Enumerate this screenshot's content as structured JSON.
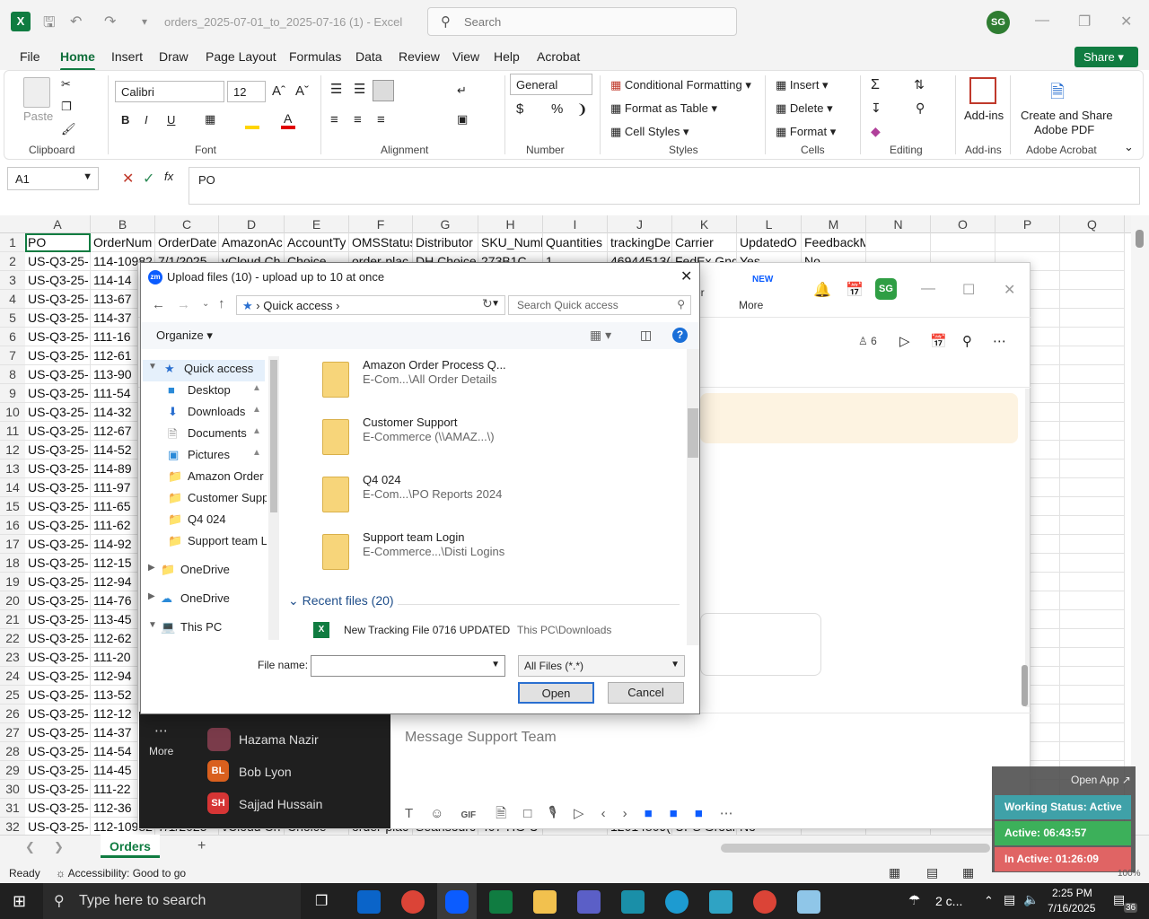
{
  "titlebar": {
    "doc_title": "orders_2025-07-01_to_2025-07-16 (1)  -  Excel",
    "search_placeholder": "Search",
    "user_initials": "SG"
  },
  "menu": {
    "items": [
      "File",
      "Home",
      "Insert",
      "Draw",
      "Page Layout",
      "Formulas",
      "Data",
      "Review",
      "View",
      "Help",
      "Acrobat"
    ],
    "share": "Share"
  },
  "ribbon": {
    "clipboard": {
      "paste": "Paste",
      "group": "Clipboard"
    },
    "font": {
      "name": "Calibri",
      "size": "12",
      "group": "Font",
      "bold": "B",
      "italic": "I",
      "underline": "U"
    },
    "alignment": {
      "group": "Alignment"
    },
    "number": {
      "format": "General",
      "group": "Number"
    },
    "styles": {
      "conditional": "Conditional Formatting",
      "format_table": "Format as Table",
      "cell_styles": "Cell Styles",
      "group": "Styles"
    },
    "cells": {
      "insert": "Insert",
      "delete": "Delete",
      "format": "Format",
      "group": "Cells"
    },
    "editing": {
      "group": "Editing"
    },
    "addins": {
      "label": "Add-ins",
      "group": "Add-ins"
    },
    "acrobat": {
      "label1": "Create and Share",
      "label2": "Adobe PDF",
      "group": "Adobe Acrobat"
    }
  },
  "formula": {
    "namebox": "A1",
    "fx": "fx",
    "value": "PO"
  },
  "grid": {
    "columns": [
      "A",
      "B",
      "C",
      "D",
      "E",
      "F",
      "G",
      "H",
      "I",
      "J",
      "K",
      "L",
      "M",
      "N",
      "O",
      "P",
      "Q"
    ],
    "header_row": [
      "PO",
      "OrderNum",
      "OrderDate",
      "AmazonAc",
      "AccountTy",
      "OMSStatus",
      "Distributor",
      "SKU_Numb",
      "Quantities",
      "trackingDe",
      "Carrier",
      "UpdatedO",
      "FeedbackMessage"
    ],
    "row2": [
      "US-Q3-25-",
      "114-10982",
      "7/1/2025",
      "vCloud Ch",
      "Choice",
      "order-plac",
      "DH Choice",
      "273B1C",
      "1",
      "46944513(",
      "FedEx Gnd",
      "Yes",
      "No"
    ],
    "col_a_prefix": "US-Q3-25-",
    "col_b": [
      "114-14",
      "113-67",
      "114-37",
      "111-16",
      "112-61",
      "113-90",
      "111-54",
      "114-32",
      "112-67",
      "114-52",
      "114-89",
      "111-97",
      "111-65",
      "111-62",
      "114-92",
      "112-15",
      "112-94",
      "114-76",
      "113-45",
      "112-62",
      "111-20",
      "112-94",
      "113-52",
      "112-12",
      "114-37",
      "114-54",
      "114-45",
      "111-22",
      "112-36"
    ],
    "row32": [
      "US-Q3-25-",
      "112-10982",
      "7/1/2025",
      "vCloud Ch",
      "Choice",
      "order-plac",
      "Seansourc",
      "407-HG-U",
      "",
      "12014809(",
      "UPS Groun",
      "No",
      ""
    ],
    "row_numbers": [
      "1",
      "2",
      "3",
      "4",
      "5",
      "6",
      "7",
      "8",
      "9",
      "10",
      "11",
      "12",
      "13",
      "14",
      "15",
      "16",
      "17",
      "18",
      "19",
      "20",
      "21",
      "22",
      "23",
      "24",
      "25",
      "26",
      "27",
      "28",
      "29",
      "30",
      "31",
      "32"
    ]
  },
  "sheet_tabs": {
    "active": "Orders"
  },
  "statusbar": {
    "ready": "Ready",
    "accessibility": "Accessibility: Good to go"
  },
  "zoom_app": {
    "new_badge": "NEW",
    "more_label": "More",
    "more_left": "More",
    "ier_fragment": "er",
    "member_count": "6",
    "avatar_initials": "SG",
    "message_placeholder": "Message Support Team",
    "contacts": [
      {
        "name": "Hazama Nazir",
        "initials": ""
      },
      {
        "name": "Bob Lyon",
        "initials": "BL",
        "color": "#d9601e"
      },
      {
        "name": "Sajjad Hussain",
        "initials": "SH",
        "color": "#d63535"
      }
    ]
  },
  "dialog": {
    "title": "Upload files (10) - upload up to 10 at once",
    "breadcrumb": "Quick access",
    "search_placeholder": "Search Quick access",
    "organize": "Organize",
    "tree": [
      {
        "label": "Quick access",
        "pin": false
      },
      {
        "label": "Desktop",
        "pin": true
      },
      {
        "label": "Downloads",
        "pin": true
      },
      {
        "label": "Documents",
        "pin": true
      },
      {
        "label": "Pictures",
        "pin": true
      },
      {
        "label": "Amazon Order P",
        "pin": false
      },
      {
        "label": "Customer Suppo",
        "pin": false
      },
      {
        "label": "Q4 024",
        "pin": false
      },
      {
        "label": "Support team Lo",
        "pin": false
      },
      {
        "label": "OneDrive",
        "pin": false
      },
      {
        "label": "OneDrive",
        "pin": false
      },
      {
        "label": "This PC",
        "pin": false
      }
    ],
    "files": [
      {
        "name": "Amazon Order Process Q...",
        "path": "E-Com...\\All Order Details"
      },
      {
        "name": "Customer Support",
        "path": "E-Commerce (\\\\AMAZ...\\)"
      },
      {
        "name": "Q4 024",
        "path": "E-Com...\\PO Reports 2024"
      },
      {
        "name": "Support team Login",
        "path": "E-Commerce...\\Disti Logins"
      }
    ],
    "recent_header": "Recent files (20)",
    "recent": [
      {
        "name": "New Tracking File 0716 UPDATED",
        "path": "This PC\\Downloads"
      }
    ],
    "filename_label": "File name:",
    "filetype": "All Files (*.*)",
    "open": "Open",
    "cancel": "Cancel"
  },
  "workstatus": {
    "open_app": "Open App",
    "status": "Working Status: Active",
    "active": "Active: 06:43:57",
    "inactive": "In Active: 01:26:09",
    "zoom_pct": "100%"
  },
  "taskbar": {
    "search_placeholder": "Type here to search",
    "weather": "2 c...",
    "time": "2:25 PM",
    "date": "7/16/2025",
    "notif_count": "36"
  }
}
